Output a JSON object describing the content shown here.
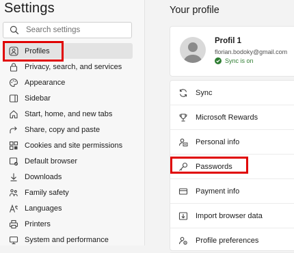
{
  "settings_title": "Settings",
  "search": {
    "placeholder": "Search settings",
    "icon": "search-icon"
  },
  "sidebar": {
    "items": [
      {
        "label": "Profiles",
        "icon": "profile-icon",
        "active": true
      },
      {
        "label": "Privacy, search, and services",
        "icon": "lock-icon"
      },
      {
        "label": "Appearance",
        "icon": "appearance-icon"
      },
      {
        "label": "Sidebar",
        "icon": "sidebar-icon"
      },
      {
        "label": "Start, home, and new tabs",
        "icon": "home-icon"
      },
      {
        "label": "Share, copy and paste",
        "icon": "share-icon"
      },
      {
        "label": "Cookies and site permissions",
        "icon": "permissions-icon"
      },
      {
        "label": "Default browser",
        "icon": "browser-icon"
      },
      {
        "label": "Downloads",
        "icon": "download-icon"
      },
      {
        "label": "Family safety",
        "icon": "family-icon"
      },
      {
        "label": "Languages",
        "icon": "language-icon"
      },
      {
        "label": "Printers",
        "icon": "printer-icon"
      },
      {
        "label": "System and performance",
        "icon": "system-icon"
      }
    ]
  },
  "main": {
    "title": "Your profile",
    "profile": {
      "name": "Profil 1",
      "email": "florian.bodoky@gmail.com",
      "sync_status": "Sync is on"
    },
    "menu": [
      {
        "label": "Sync",
        "icon": "sync-icon"
      },
      {
        "label": "Microsoft Rewards",
        "icon": "trophy-icon"
      },
      {
        "label": "Personal info",
        "icon": "personal-info-icon"
      },
      {
        "label": "Passwords",
        "icon": "key-icon"
      },
      {
        "label": "Payment info",
        "icon": "card-icon"
      },
      {
        "label": "Import browser data",
        "icon": "import-icon"
      },
      {
        "label": "Profile preferences",
        "icon": "profile-preferences-icon"
      }
    ]
  },
  "colors": {
    "highlight": "#e00000",
    "sync_ok": "#2e7d32"
  }
}
